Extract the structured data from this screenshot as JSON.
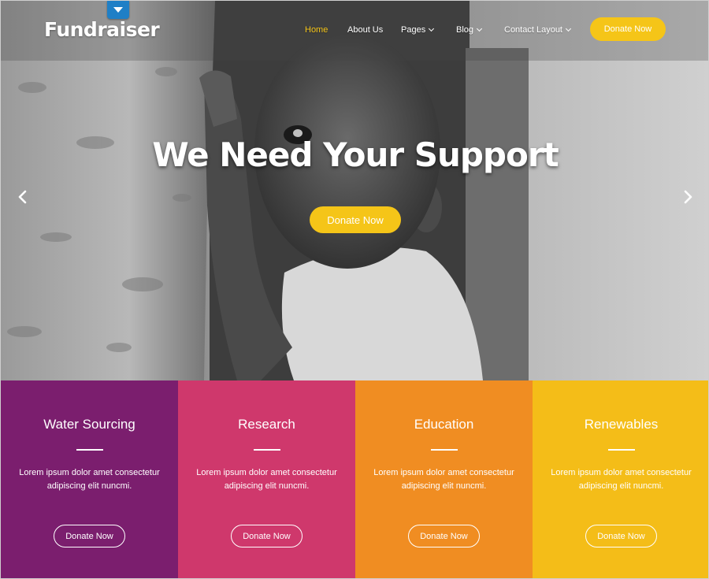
{
  "brand": {
    "name": "Fundraiser",
    "tab_icon": "caret-down-icon"
  },
  "nav": {
    "items": [
      {
        "label": "Home",
        "active": true,
        "dropdown": false
      },
      {
        "label": "About Us",
        "active": false,
        "dropdown": false
      },
      {
        "label": "Pages",
        "active": false,
        "dropdown": true
      },
      {
        "label": "Blog",
        "active": false,
        "dropdown": true
      },
      {
        "label": "Contact Layout",
        "active": false,
        "dropdown": true
      }
    ],
    "donate_label": "Donate Now"
  },
  "hero": {
    "headline": "We Need Your Support",
    "donate_label": "Donate Now",
    "prev_icon": "chevron-left-icon",
    "next_icon": "chevron-right-icon"
  },
  "cards": [
    {
      "title": "Water Sourcing",
      "text": "Lorem ipsum dolor amet consectetur adipiscing elit nuncmi.",
      "button": "Donate Now",
      "color": "#7b1e6e"
    },
    {
      "title": "Research",
      "text": "Lorem ipsum dolor amet consectetur adipiscing elit nuncmi.",
      "button": "Donate Now",
      "color": "#cf386c"
    },
    {
      "title": "Education",
      "text": "Lorem ipsum dolor amet consectetur adipiscing elit nuncmi.",
      "button": "Donate Now",
      "color": "#f08d22"
    },
    {
      "title": "Renewables",
      "text": "Lorem ipsum dolor amet consectetur adipiscing elit nuncmi.",
      "button": "Donate Now",
      "color": "#f4bd18"
    }
  ],
  "colors": {
    "accent": "#f5c518",
    "active_nav": "#f5c518",
    "logo_tab": "#1f7fc6"
  }
}
